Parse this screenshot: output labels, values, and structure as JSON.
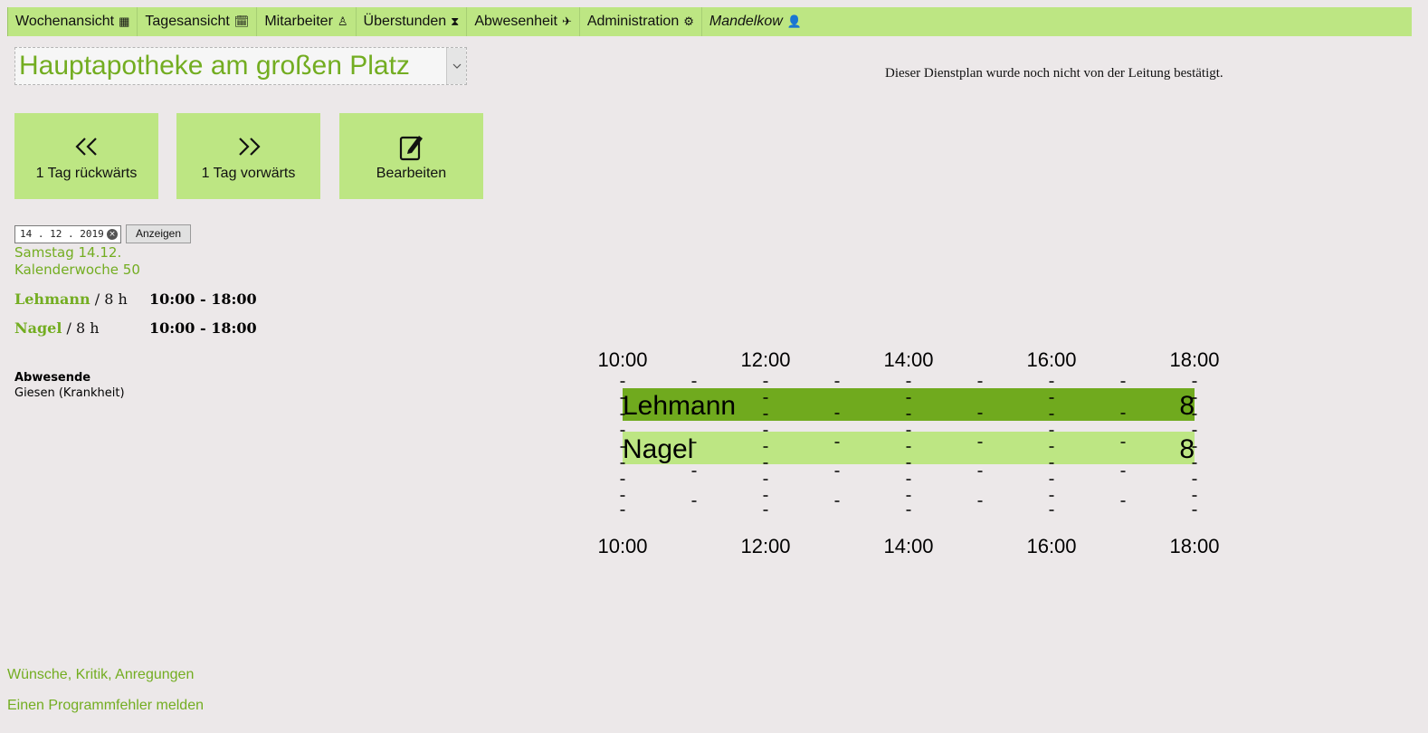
{
  "nav": {
    "items": [
      {
        "label": "Wochenansicht",
        "icon": "calendar-grid-icon",
        "glyph": "▦"
      },
      {
        "label": "Tagesansicht",
        "icon": "calendar-day-icon",
        "glyph": "🗓"
      },
      {
        "label": "Mitarbeiter",
        "icon": "person-icon",
        "glyph": "♙"
      },
      {
        "label": "Überstunden",
        "icon": "hourglass-icon",
        "glyph": "⧗"
      },
      {
        "label": "Abwesenheit",
        "icon": "plane-icon",
        "glyph": "✈"
      },
      {
        "label": "Administration",
        "icon": "gear-icon",
        "glyph": "⚙"
      }
    ],
    "user": {
      "label": "Mandelkow",
      "icon": "user-icon",
      "glyph": "👤"
    }
  },
  "branch": {
    "selected": "Hauptapotheke am großen Platz"
  },
  "confirmation_note": "Dieser Dienstplan wurde noch nicht von der Leitung bestätigt.",
  "actions": {
    "back_label": "1 Tag rückwärts",
    "forward_label": "1 Tag vorwärts",
    "edit_label": "Bearbeiten"
  },
  "date_picker": {
    "value": "14.12.2019",
    "display": "14 . 12 . 2019",
    "button_label": "Anzeigen"
  },
  "day": {
    "label": "Samstag 14.12.",
    "week_label": "Kalenderwoche 50"
  },
  "shifts": [
    {
      "employee": "Lehmann",
      "hours_text": " / 8 h",
      "time": "10:00 - 18:00"
    },
    {
      "employee": "Nagel",
      "hours_text": " / 8 h",
      "time": "10:00 - 18:00"
    }
  ],
  "absences": {
    "title": "Abwesende",
    "entries": [
      "Giesen (Krankheit)"
    ]
  },
  "chart_data": {
    "type": "bar",
    "orientation": "horizontal",
    "x_ticks": [
      "10:00",
      "12:00",
      "14:00",
      "16:00",
      "18:00"
    ],
    "xlim": [
      10,
      18
    ],
    "series": [
      {
        "name": "Lehmann",
        "start": 10,
        "end": 18,
        "hours": 8,
        "color": "#70aa1e"
      },
      {
        "name": "Nagel",
        "start": 10,
        "end": 18,
        "hours": 8,
        "color": "#bde683"
      }
    ]
  },
  "footer": {
    "feedback_link": "Wünsche, Kritik, Anregungen",
    "bug_link": "Einen Programmfehler melden"
  },
  "colors": {
    "accent": "#73ad21",
    "nav_bg": "#bde683",
    "page_bg": "#ece8e9"
  }
}
